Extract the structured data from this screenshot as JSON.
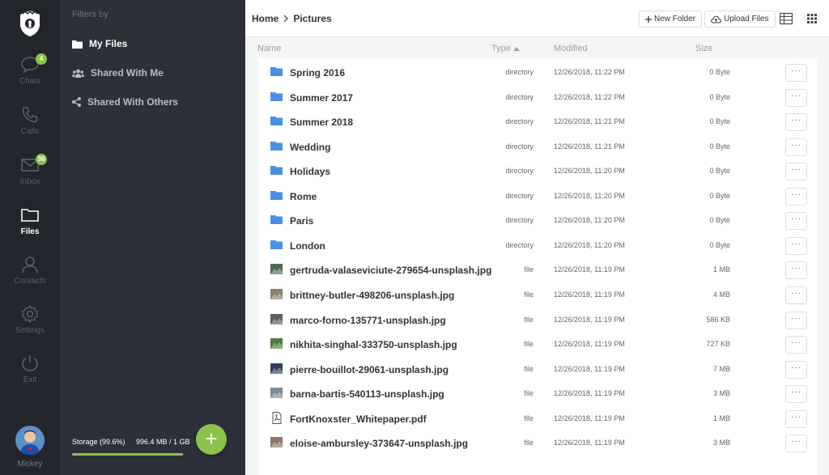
{
  "rail": {
    "items": [
      {
        "label": "Chats",
        "badge": "4"
      },
      {
        "label": "Calls"
      },
      {
        "label": "Inbox",
        "badge": "36"
      },
      {
        "label": "Files"
      },
      {
        "label": "Contacts"
      },
      {
        "label": "Settings"
      },
      {
        "label": "Exit"
      }
    ],
    "user_name": "Mickey"
  },
  "filters": {
    "title": "Filters by",
    "items": [
      "My Files",
      "Shared With Me",
      "Shared With Others"
    ],
    "storage_label": "Storage (99.6%)",
    "storage_value": "996.4 MB / 1 GB",
    "storage_fraction": 0.996,
    "add_label": "+"
  },
  "breadcrumb": {
    "home": "Home",
    "current": "Pictures"
  },
  "toolbar": {
    "new_folder": "New Folder",
    "upload": "Upload Files"
  },
  "columns": {
    "name": "Name",
    "type": "Type",
    "modified": "Modified",
    "size": "Size"
  },
  "files": [
    {
      "name": "Spring 2016",
      "type": "directory",
      "modified": "12/26/2018, 11:22 PM",
      "size": "0 Byte",
      "kind": "folder",
      "more": "···"
    },
    {
      "name": "Summer 2017",
      "type": "directory",
      "modified": "12/26/2018, 11:22 PM",
      "size": "0 Byte",
      "kind": "folder",
      "more": "···"
    },
    {
      "name": "Summer 2018",
      "type": "directory",
      "modified": "12/26/2018, 11:21 PM",
      "size": "0 Byte",
      "kind": "folder",
      "more": "···"
    },
    {
      "name": "Wedding",
      "type": "directory",
      "modified": "12/26/2018, 11:21 PM",
      "size": "0 Byte",
      "kind": "folder",
      "more": "···"
    },
    {
      "name": "Holidays",
      "type": "directory",
      "modified": "12/26/2018, 11:20 PM",
      "size": "0 Byte",
      "kind": "folder",
      "more": "···"
    },
    {
      "name": "Rome",
      "type": "directory",
      "modified": "12/26/2018, 11:20 PM",
      "size": "0 Byte",
      "kind": "folder",
      "more": "···"
    },
    {
      "name": "Paris",
      "type": "directory",
      "modified": "12/26/2018, 11:20 PM",
      "size": "0 Byte",
      "kind": "folder",
      "more": "···"
    },
    {
      "name": "London",
      "type": "directory",
      "modified": "12/26/2018, 11:20 PM",
      "size": "0 Byte",
      "kind": "folder",
      "more": "···"
    },
    {
      "name": "gertruda-valaseviciute-279654-unsplash.jpg",
      "type": "file",
      "modified": "12/26/2018, 11:19 PM",
      "size": "1 MB",
      "kind": "image",
      "thumb": "#4c6b57",
      "more": "···"
    },
    {
      "name": "brittney-butler-498206-unsplash.jpg",
      "type": "file",
      "modified": "12/26/2018, 11:19 PM",
      "size": "4 MB",
      "kind": "image",
      "thumb": "#8a7f6a",
      "more": "···"
    },
    {
      "name": "marco-forno-135771-unsplash.jpg",
      "type": "file",
      "modified": "12/26/2018, 11:19 PM",
      "size": "586 KB",
      "kind": "image",
      "thumb": "#5a5f66",
      "more": "···"
    },
    {
      "name": "nikhita-singhal-333750-unsplash.jpg",
      "type": "file",
      "modified": "12/26/2018, 11:19 PM",
      "size": "727 KB",
      "kind": "image",
      "thumb": "#4f7a3c",
      "more": "···"
    },
    {
      "name": "pierre-bouillot-29061-unsplash.jpg",
      "type": "file",
      "modified": "12/26/2018, 11:19 PM",
      "size": "7 MB",
      "kind": "image",
      "thumb": "#2f3f57",
      "more": "···"
    },
    {
      "name": "barna-bartis-540113-unsplash.jpg",
      "type": "file",
      "modified": "12/26/2018, 11:19 PM",
      "size": "3 MB",
      "kind": "image",
      "thumb": "#7d8a94",
      "more": "···"
    },
    {
      "name": "FortKnoxster_Whitepaper.pdf",
      "type": "file",
      "modified": "12/26/2018, 11:19 PM",
      "size": "1 MB",
      "kind": "pdf",
      "more": "···"
    },
    {
      "name": "eloise-ambursley-373647-unsplash.jpg",
      "type": "file",
      "modified": "12/26/2018, 11:19 PM",
      "size": "3 MB",
      "kind": "image",
      "thumb": "#8c7768",
      "more": "···"
    }
  ],
  "colors": {
    "accent": "#8ac34a",
    "folder": "#4a90e2",
    "rail_bg": "#22252b",
    "panel_bg": "#2d3039"
  }
}
